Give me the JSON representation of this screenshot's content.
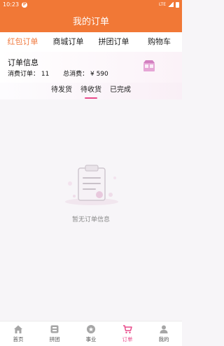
{
  "status_bar": {
    "time": "10:23",
    "network": "LTE"
  },
  "header": {
    "title": "我的订单"
  },
  "tabs": [
    {
      "label": "红包订单",
      "active": true
    },
    {
      "label": "商城订单",
      "active": false
    },
    {
      "label": "拼团订单",
      "active": false
    },
    {
      "label": "购物车",
      "active": false
    }
  ],
  "order_info": {
    "title": "订单信息",
    "order_count_label": "消费订单：",
    "order_count": "11",
    "total_label": "总消费：",
    "total_value": "¥ 590"
  },
  "subtabs": [
    {
      "label": "待发货",
      "active": false
    },
    {
      "label": "待收货",
      "active": true
    },
    {
      "label": "已完成",
      "active": false
    }
  ],
  "empty_state": {
    "text": "暂无订单信息",
    "icon": "clipboard-icon"
  },
  "bottom_nav": [
    {
      "label": "首页",
      "icon": "home-icon",
      "active": false
    },
    {
      "label": "拼团",
      "icon": "group-buy-icon",
      "active": false
    },
    {
      "label": "事业",
      "icon": "career-icon",
      "active": false
    },
    {
      "label": "订单",
      "icon": "cart-icon",
      "active": true
    },
    {
      "label": "我的",
      "icon": "user-icon",
      "active": false
    }
  ],
  "colors": {
    "primary": "#f17836",
    "accent": "#e84a8a",
    "active_tab": "#f07a3f"
  }
}
